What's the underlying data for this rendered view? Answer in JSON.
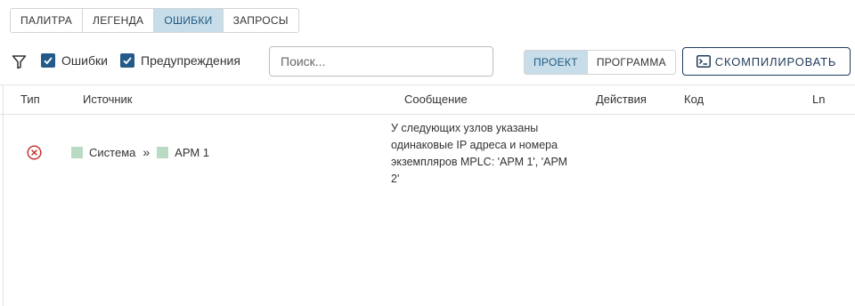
{
  "tabs": [
    {
      "label": "ПАЛИТРА",
      "active": false
    },
    {
      "label": "ЛЕГЕНДА",
      "active": false
    },
    {
      "label": "ОШИБКИ",
      "active": true
    },
    {
      "label": "ЗАПРОСЫ",
      "active": false
    }
  ],
  "toolbar": {
    "filter_icon": "filter-icon",
    "errors_checkbox": {
      "label": "Ошибки",
      "checked": true
    },
    "warnings_checkbox": {
      "label": "Предупреждения",
      "checked": true
    },
    "search": {
      "value": "",
      "placeholder": "Поиск..."
    },
    "scope": {
      "options": [
        "ПРОЕКТ",
        "ПРОГРАММА"
      ],
      "selected": "ПРОЕКТ"
    },
    "compile_button": {
      "label": "СКОМПИЛИРОВАТЬ",
      "icon": "terminal-icon"
    }
  },
  "table": {
    "columns": [
      "Тип",
      "Источник",
      "Сообщение",
      "Действия",
      "Код",
      "Ln"
    ],
    "rows": [
      {
        "type": "error",
        "type_icon": "error-circle-icon",
        "source": {
          "parts": [
            "Система",
            "АРМ 1"
          ],
          "separator": "»"
        },
        "message": "У следующих узлов указаны одинаковые IP адреса и номера экземпляров MPLC: 'АРМ 1', 'АРМ 2'",
        "actions": "",
        "code": "",
        "ln": ""
      }
    ]
  },
  "colors": {
    "accent": "#245a8a",
    "active_tab_bg": "#c7dde9",
    "error": "#c62828",
    "source_tag": "#b9dbc4"
  }
}
